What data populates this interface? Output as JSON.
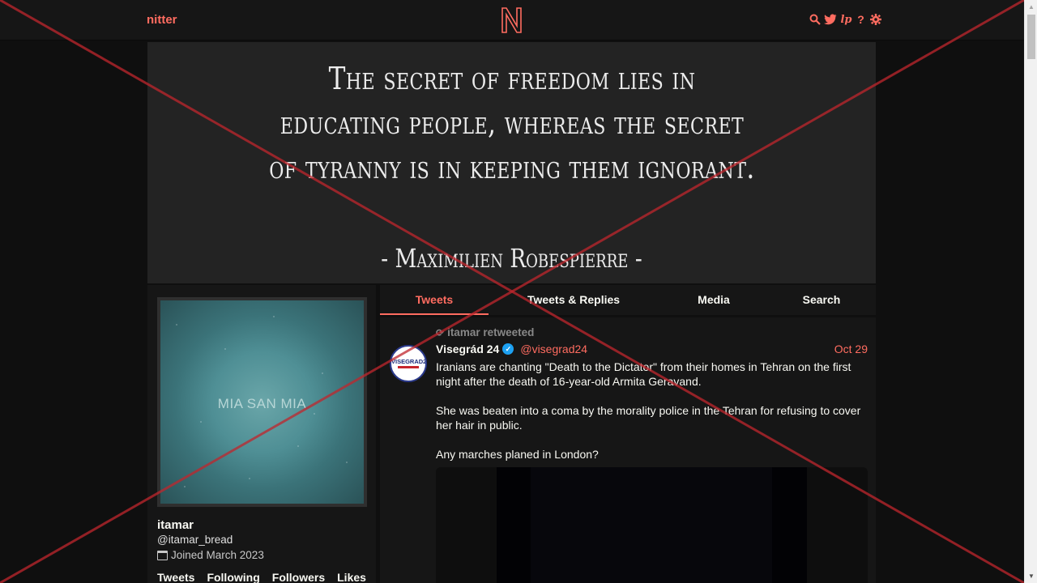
{
  "nav": {
    "brand": "nitter",
    "icons": [
      "search-icon",
      "twitter-icon",
      "lp-icon",
      "help-icon",
      "settings-icon"
    ]
  },
  "banner": {
    "quote": "The secret of freedom lies in educating people, whereas the secret of tyranny is in keeping them ignorant.",
    "author": "- Maximilien Robespierre -"
  },
  "profile": {
    "avatar_text": "MIA SAN MIA",
    "name": "itamar",
    "username": "@itamar_bread",
    "joined": "Joined March 2023",
    "stats": [
      "Tweets",
      "Following",
      "Followers",
      "Likes"
    ]
  },
  "tabs": [
    "Tweets",
    "Tweets & Replies",
    "Media",
    "Search"
  ],
  "tweet": {
    "retweet_label": "itamar retweeted",
    "avatar_text": "VISEGRAD24",
    "fullname": "Visegrád 24",
    "handle": "@visegrad24",
    "date": "Oct 29",
    "paragraphs": [
      "Iranians are chanting \"Death to the Dictator\" from their homes in Tehran on the first night after the death of 16-year-old Armita Geravand.",
      "She was beaten into a coma by the morality police in the Tehran for refusing to cover her hair in public.",
      "Any marches planed in London?"
    ]
  },
  "colors": {
    "accent": "#ff6c60",
    "background": "#0f0f0f",
    "panel": "#161616",
    "overlay_x": "#c0262d"
  }
}
